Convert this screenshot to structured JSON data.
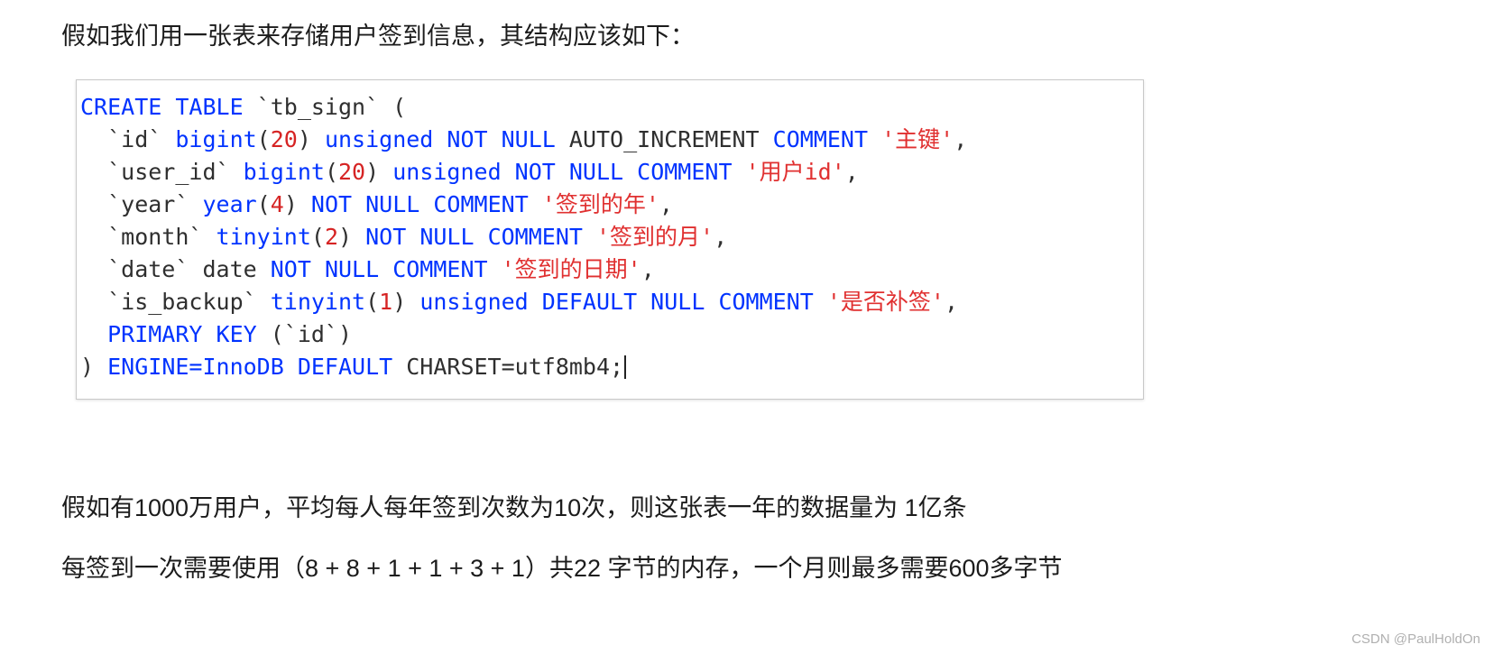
{
  "intro": "假如我们用一张表来存储用户签到信息，其结构应该如下：",
  "code": {
    "lines": [
      [
        {
          "t": "CREATE TABLE ",
          "c": "kw"
        },
        {
          "t": "`tb_sign` (",
          "c": "plain"
        }
      ],
      [
        {
          "t": "  `id` ",
          "c": "plain"
        },
        {
          "t": "bigint",
          "c": "kw"
        },
        {
          "t": "(",
          "c": "plain"
        },
        {
          "t": "20",
          "c": "num"
        },
        {
          "t": ") ",
          "c": "plain"
        },
        {
          "t": "unsigned NOT NULL ",
          "c": "kw"
        },
        {
          "t": "AUTO_INCREMENT ",
          "c": "plain"
        },
        {
          "t": "COMMENT ",
          "c": "kw"
        },
        {
          "t": "'主键'",
          "c": "str"
        },
        {
          "t": ",",
          "c": "plain"
        }
      ],
      [
        {
          "t": "  `user_id` ",
          "c": "plain"
        },
        {
          "t": "bigint",
          "c": "kw"
        },
        {
          "t": "(",
          "c": "plain"
        },
        {
          "t": "20",
          "c": "num"
        },
        {
          "t": ") ",
          "c": "plain"
        },
        {
          "t": "unsigned NOT NULL COMMENT ",
          "c": "kw"
        },
        {
          "t": "'用户id'",
          "c": "str"
        },
        {
          "t": ",",
          "c": "plain"
        }
      ],
      [
        {
          "t": "  `year` ",
          "c": "plain"
        },
        {
          "t": "year",
          "c": "kw"
        },
        {
          "t": "(",
          "c": "plain"
        },
        {
          "t": "4",
          "c": "num"
        },
        {
          "t": ") ",
          "c": "plain"
        },
        {
          "t": "NOT NULL COMMENT ",
          "c": "kw"
        },
        {
          "t": "'签到的年'",
          "c": "str"
        },
        {
          "t": ",",
          "c": "plain"
        }
      ],
      [
        {
          "t": "  `month` ",
          "c": "plain"
        },
        {
          "t": "tinyint",
          "c": "kw"
        },
        {
          "t": "(",
          "c": "plain"
        },
        {
          "t": "2",
          "c": "num"
        },
        {
          "t": ") ",
          "c": "plain"
        },
        {
          "t": "NOT NULL COMMENT ",
          "c": "kw"
        },
        {
          "t": "'签到的月'",
          "c": "str"
        },
        {
          "t": ",",
          "c": "plain"
        }
      ],
      [
        {
          "t": "  `date` ",
          "c": "plain"
        },
        {
          "t": "date ",
          "c": "plain"
        },
        {
          "t": "NOT NULL COMMENT ",
          "c": "kw"
        },
        {
          "t": "'签到的日期'",
          "c": "str"
        },
        {
          "t": ",",
          "c": "plain"
        }
      ],
      [
        {
          "t": "  `is_backup` ",
          "c": "plain"
        },
        {
          "t": "tinyint",
          "c": "kw"
        },
        {
          "t": "(",
          "c": "plain"
        },
        {
          "t": "1",
          "c": "num"
        },
        {
          "t": ") ",
          "c": "plain"
        },
        {
          "t": "unsigned DEFAULT NULL COMMENT ",
          "c": "kw"
        },
        {
          "t": "'是否补签'",
          "c": "str"
        },
        {
          "t": ",",
          "c": "plain"
        }
      ],
      [
        {
          "t": "  PRIMARY KEY ",
          "c": "kw"
        },
        {
          "t": "(`id`)",
          "c": "plain"
        }
      ],
      [
        {
          "t": ") ",
          "c": "plain"
        },
        {
          "t": "ENGINE=InnoDB DEFAULT ",
          "c": "kw"
        },
        {
          "t": "CHARSET=utf8mb4;",
          "c": "plain"
        }
      ]
    ]
  },
  "paragraphs": {
    "line1": "假如有1000万用户，平均每人每年签到次数为10次，则这张表一年的数据量为 1亿条",
    "line2": "每签到一次需要使用（8 + 8 + 1 + 1 + 3 + 1）共22 字节的内存，一个月则最多需要600多字节"
  },
  "watermark": "CSDN @PaulHoldOn"
}
